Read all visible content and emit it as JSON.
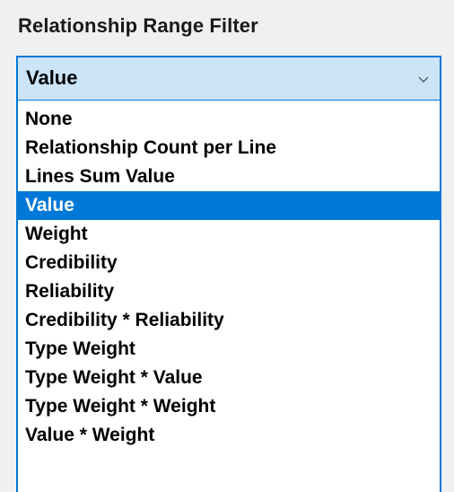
{
  "filter": {
    "title": "Relationship Range Filter",
    "selected_value": "Value",
    "arrow_icon": "chevron-down-icon",
    "accent_color": "#0078d7",
    "combo_background": "#cce4f7",
    "options": [
      {
        "label": "None",
        "selected": false
      },
      {
        "label": "Relationship Count per Line",
        "selected": false
      },
      {
        "label": "Lines Sum Value",
        "selected": false
      },
      {
        "label": "Value",
        "selected": true
      },
      {
        "label": "Weight",
        "selected": false
      },
      {
        "label": "Credibility",
        "selected": false
      },
      {
        "label": "Reliability",
        "selected": false
      },
      {
        "label": "Credibility * Reliability",
        "selected": false
      },
      {
        "label": "Type Weight",
        "selected": false
      },
      {
        "label": "Type Weight * Value",
        "selected": false
      },
      {
        "label": "Type Weight * Weight",
        "selected": false
      },
      {
        "label": "Value * Weight",
        "selected": false
      }
    ]
  }
}
